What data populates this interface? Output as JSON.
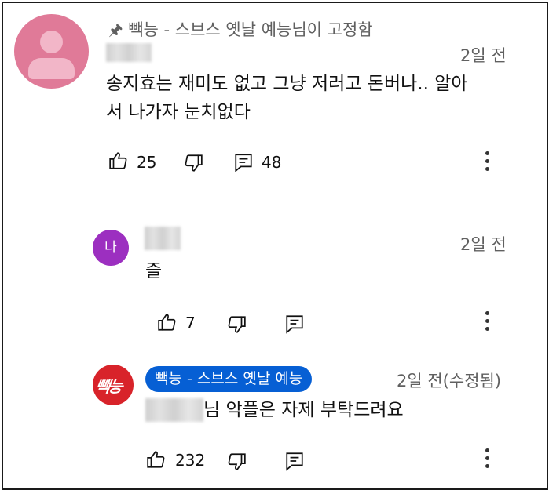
{
  "pinned": {
    "pin_text": "빽능 - 스브스 옛날 예능님이 고정함"
  },
  "comments": [
    {
      "date": "2일 전",
      "text_line1": "송지효는 재미도 없고 그냥 저러고 돈버나.. 알아",
      "text_line2": "서 나가자 눈치없다",
      "likes": "25",
      "replies": "48"
    },
    {
      "avatar_letter": "나",
      "date": "2일 전",
      "text": "즐",
      "likes": "7"
    },
    {
      "author_badge": "빽능 - 스브스 옛날 예능",
      "avatar_logo": "빽능",
      "date": "2일 전(수정됨)",
      "text_suffix": "님 악플은 자제 부탁드려요",
      "likes": "232"
    }
  ],
  "colors": {
    "avatar_default": "#e07a98",
    "avatar_na": "#9c2fc0",
    "channel_red": "#d8232a",
    "badge_blue": "#065fd4"
  },
  "icons": [
    "pin-icon",
    "thumbs-up-icon",
    "thumbs-down-icon",
    "reply-icon",
    "more-vert-icon"
  ]
}
